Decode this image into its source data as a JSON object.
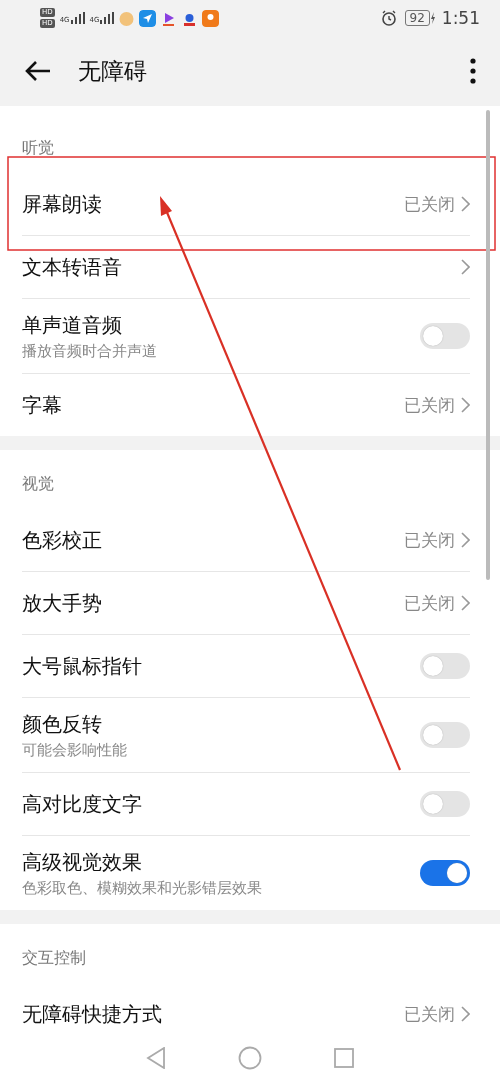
{
  "status_bar": {
    "sim_labels": [
      "HD",
      "HD"
    ],
    "network": [
      "4G",
      "4G"
    ],
    "battery": "92",
    "time": "1:51"
  },
  "header": {
    "title": "无障碍"
  },
  "sections": [
    {
      "title": "听觉",
      "rows": [
        {
          "kind": "link",
          "label": "屏幕朗读",
          "value": "已关闭"
        },
        {
          "kind": "link",
          "label": "文本转语音"
        },
        {
          "kind": "toggle",
          "label": "单声道音频",
          "subtitle": "播放音频时合并声道",
          "on": false
        },
        {
          "kind": "link",
          "label": "字幕",
          "value": "已关闭"
        }
      ]
    },
    {
      "title": "视觉",
      "rows": [
        {
          "kind": "link",
          "label": "色彩校正",
          "value": "已关闭"
        },
        {
          "kind": "link",
          "label": "放大手势",
          "value": "已关闭"
        },
        {
          "kind": "toggle",
          "label": "大号鼠标指针",
          "on": false
        },
        {
          "kind": "toggle",
          "label": "颜色反转",
          "subtitle": "可能会影响性能",
          "on": false
        },
        {
          "kind": "toggle",
          "label": "高对比度文字",
          "on": false
        },
        {
          "kind": "toggle",
          "label": "高级视觉效果",
          "subtitle": "色彩取色、模糊效果和光影错层效果",
          "on": true
        }
      ]
    },
    {
      "title": "交互控制",
      "rows": [
        {
          "kind": "link",
          "label": "无障碍快捷方式",
          "value": "已关闭"
        }
      ]
    }
  ],
  "annotations": [
    {
      "kind": "box"
    },
    {
      "kind": "arrow"
    }
  ]
}
